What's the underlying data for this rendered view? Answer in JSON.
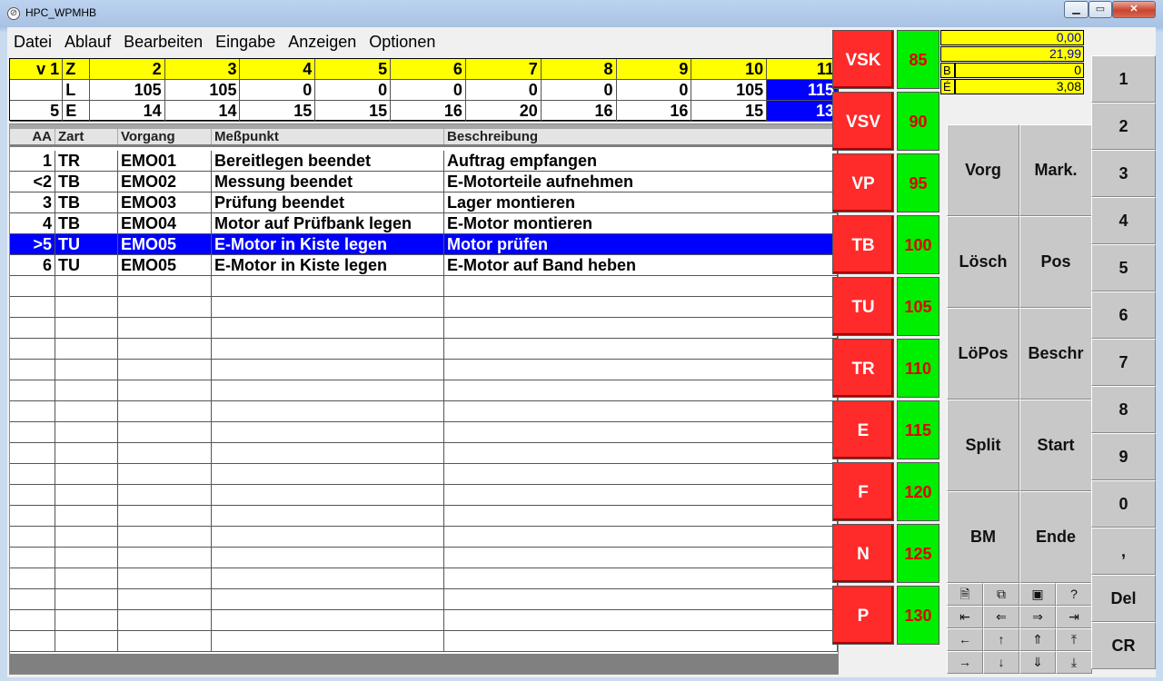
{
  "window": {
    "title": "HPC_WPMHB",
    "min_label": "▭",
    "max_label": "❐",
    "close_label": "✕"
  },
  "menu": [
    "Datei",
    "Ablauf",
    "Bearbeiten",
    "Eingabe",
    "Anzeigen",
    "Optionen"
  ],
  "params": {
    "row_z": {
      "label": "v 1",
      "kind": "Z",
      "values": [
        "2",
        "3",
        "4",
        "5",
        "6",
        "7",
        "8",
        "9",
        "10",
        "11"
      ]
    },
    "row_l": {
      "label": "",
      "kind": "L",
      "values": [
        "105",
        "105",
        "0",
        "0",
        "0",
        "0",
        "0",
        "0",
        "105",
        "115"
      ]
    },
    "row_e": {
      "label": "5",
      "kind": "E",
      "values": [
        "14",
        "14",
        "15",
        "15",
        "16",
        "20",
        "16",
        "16",
        "15",
        "13"
      ]
    },
    "selected_col_index": 9
  },
  "grid": {
    "headers": [
      "AA",
      "Zart",
      "Vorgang",
      "Meßpunkt",
      "Beschreibung"
    ],
    "rows": [
      [
        "1",
        "TR",
        "EMO01",
        "Bereitlegen beendet",
        "Auftrag empfangen"
      ],
      [
        "<2",
        "TB",
        "EMO02",
        "Messung beendet",
        "E-Motorteile aufnehmen"
      ],
      [
        "3",
        "TB",
        "EMO03",
        "Prüfung beendet",
        "Lager montieren"
      ],
      [
        "4",
        "TB",
        "EMO04",
        "Motor auf Prüfbank legen",
        "E-Motor montieren"
      ],
      [
        ">5",
        "TU",
        "EMO05",
        "E-Motor in Kiste legen",
        "Motor prüfen"
      ],
      [
        "6",
        "TU",
        "EMO05",
        "E-Motor in Kiste legen",
        "E-Motor auf Band heben"
      ]
    ],
    "selected_row_index": 4,
    "empty_rows": 18
  },
  "codes": [
    {
      "code": "VSK",
      "value": "85"
    },
    {
      "code": "VSV",
      "value": "90"
    },
    {
      "code": "VP",
      "value": "95"
    },
    {
      "code": "TB",
      "value": "100"
    },
    {
      "code": "TU",
      "value": "105"
    },
    {
      "code": "TR",
      "value": "110"
    },
    {
      "code": "E",
      "value": "115"
    },
    {
      "code": "F",
      "value": "120"
    },
    {
      "code": "N",
      "value": "125"
    },
    {
      "code": "P",
      "value": "130"
    }
  ],
  "info": {
    "v1": "0,00",
    "v2": "21,99",
    "b_label": "B",
    "b_value": "0",
    "e_label": "É",
    "e_value": "3,08"
  },
  "functions": [
    "Vorg",
    "Mark.",
    "Lösch",
    "Pos",
    "LöPos",
    "Beschr",
    "Split",
    "Start",
    "BM",
    "Ende"
  ],
  "toolbar": [
    {
      "icon": "new-doc-icon",
      "glyph": "🗎"
    },
    {
      "icon": "copy-doc-icon",
      "glyph": "⧉"
    },
    {
      "icon": "save-icon",
      "glyph": "▣"
    },
    {
      "icon": "help-icon",
      "glyph": "?"
    },
    {
      "icon": "first-icon",
      "glyph": "⇤"
    },
    {
      "icon": "prev-icon",
      "glyph": "⇐"
    },
    {
      "icon": "next-icon",
      "glyph": "⇒"
    },
    {
      "icon": "last-icon",
      "glyph": "⇥"
    },
    {
      "icon": "left-icon",
      "glyph": "←"
    },
    {
      "icon": "up-icon",
      "glyph": "↑"
    },
    {
      "icon": "page-up-icon",
      "glyph": "⇑"
    },
    {
      "icon": "top-icon",
      "glyph": "⤒"
    },
    {
      "icon": "right-icon",
      "glyph": "→"
    },
    {
      "icon": "down-icon",
      "glyph": "↓"
    },
    {
      "icon": "page-down-icon",
      "glyph": "⇓"
    },
    {
      "icon": "bottom-icon",
      "glyph": "⤓"
    }
  ],
  "keypad": [
    "1",
    "2",
    "3",
    "4",
    "5",
    "6",
    "7",
    "8",
    "9",
    "0",
    ",",
    "Del",
    "CR"
  ],
  "colors": {
    "selection": "#0000ff",
    "param_header": "#ffff00",
    "code_button": "#ff2a2a",
    "code_value_bg": "#00ee00",
    "code_value_text": "#e00000"
  }
}
